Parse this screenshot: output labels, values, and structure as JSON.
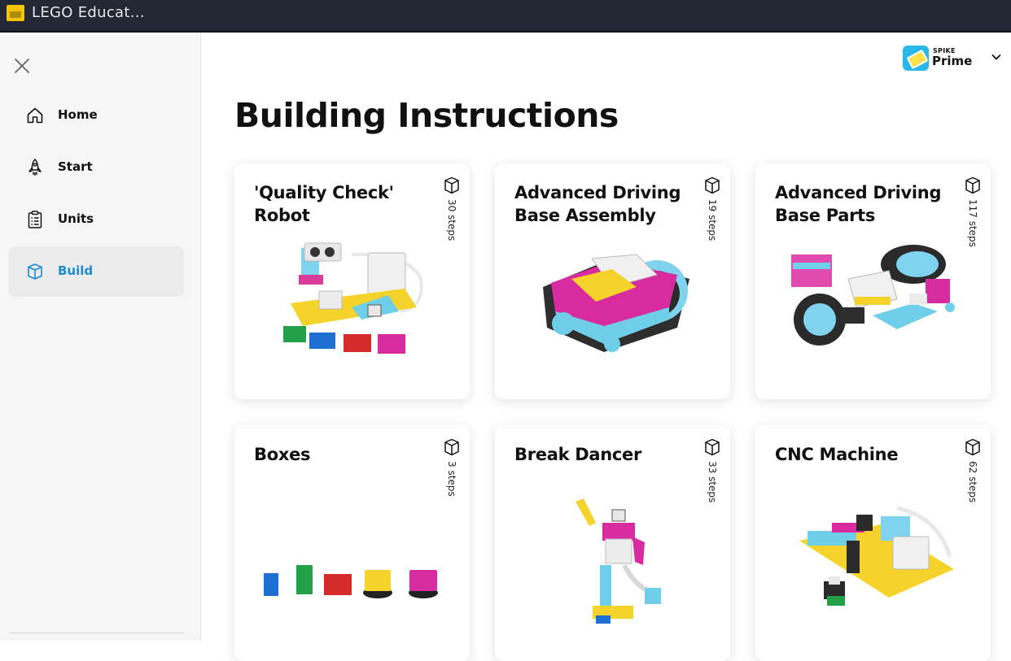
{
  "window": {
    "title": "LEGO Educat..."
  },
  "sidebar": {
    "items": [
      {
        "label": "Home",
        "icon": "home-icon"
      },
      {
        "label": "Start",
        "icon": "rocket-icon"
      },
      {
        "label": "Units",
        "icon": "clipboard-icon"
      },
      {
        "label": "Build",
        "icon": "cube-icon",
        "active": true
      }
    ]
  },
  "product": {
    "line1": "SPIKE",
    "line2": "Prime"
  },
  "page": {
    "title": "Building Instructions"
  },
  "cards": [
    {
      "title": "'Quality Check' Robot",
      "steps": "30 steps"
    },
    {
      "title": "Advanced Driving Base Assembly",
      "steps": "19 steps"
    },
    {
      "title": "Advanced Driving Base Parts",
      "steps": "117 steps"
    },
    {
      "title": "Boxes",
      "steps": "3 steps"
    },
    {
      "title": "Break Dancer",
      "steps": "33 steps"
    },
    {
      "title": "CNC Machine",
      "steps": "62 steps"
    }
  ],
  "colors": {
    "accent": "#1a8ad4",
    "titlebar": "#232733",
    "sidebar": "#f6f6f6"
  }
}
